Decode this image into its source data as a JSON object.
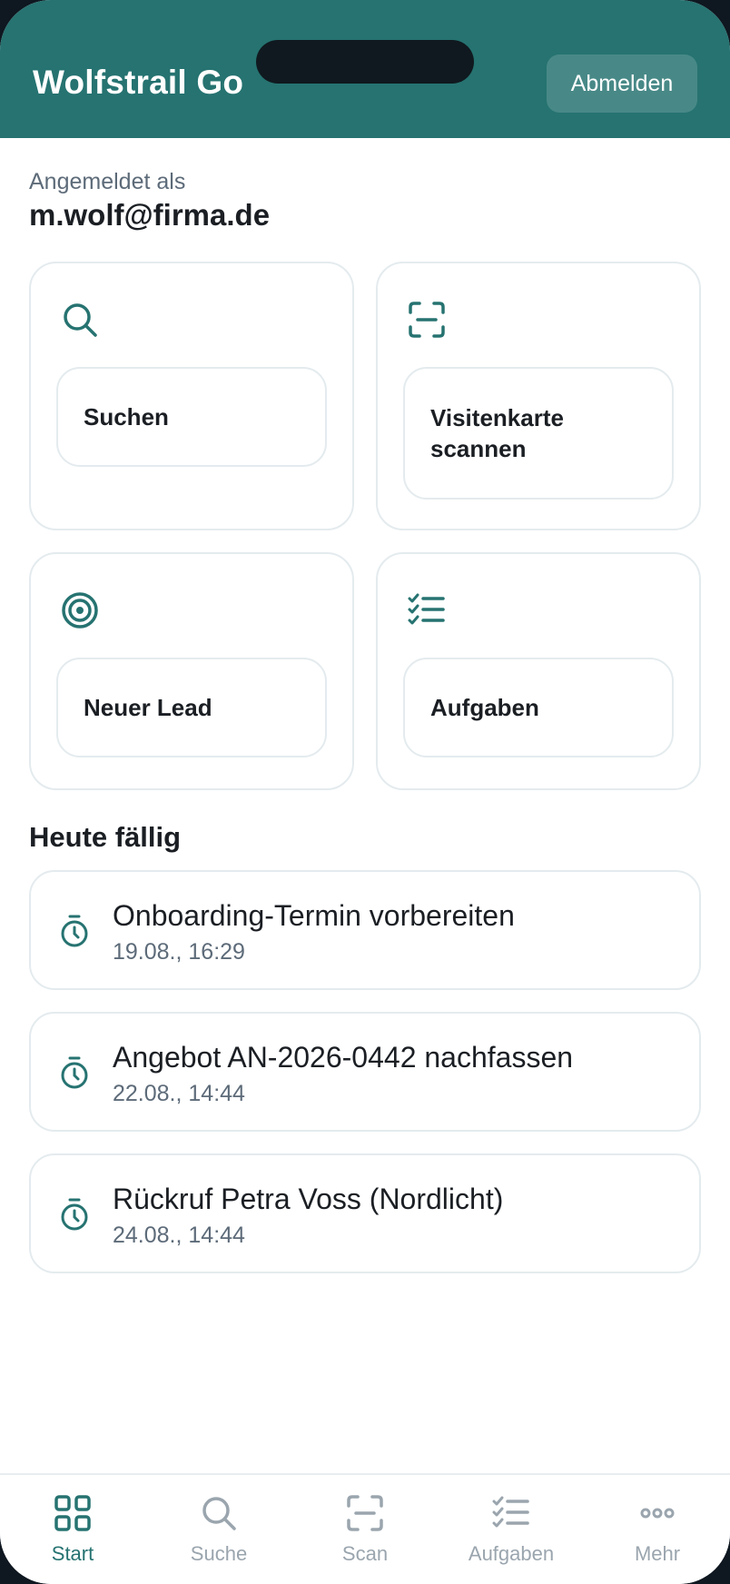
{
  "header": {
    "title": "Wolfstrail Go",
    "logout_label": "Abmelden"
  },
  "account": {
    "label": "Angemeldet als",
    "email": "m.wolf@firma.de"
  },
  "tiles": [
    {
      "label": "Suchen",
      "icon": "search-icon"
    },
    {
      "label": "Visitenkarte scannen",
      "icon": "scan-icon"
    },
    {
      "label": "Neuer Lead",
      "icon": "target-icon"
    },
    {
      "label": "Aufgaben",
      "icon": "checklist-icon"
    }
  ],
  "due_today": {
    "title": "Heute fällig",
    "tasks": [
      {
        "title": "Onboarding-Termin vorbereiten",
        "time": "19.08., 16:29",
        "icon": "timer-icon"
      },
      {
        "title": "Angebot AN-2026-0442 nachfassen",
        "time": "22.08., 14:44",
        "icon": "timer-icon"
      },
      {
        "title": "Rückruf Petra Voss (Nordlicht)",
        "time": "24.08., 14:44",
        "icon": "timer-icon"
      }
    ]
  },
  "tabbar": {
    "items": [
      {
        "label": "Start",
        "icon": "grid-icon",
        "active": true
      },
      {
        "label": "Suche",
        "icon": "search-icon",
        "active": false
      },
      {
        "label": "Scan",
        "icon": "scan-icon",
        "active": false
      },
      {
        "label": "Aufgaben",
        "icon": "checklist-icon",
        "active": false
      },
      {
        "label": "Mehr",
        "icon": "more-icon",
        "active": false
      }
    ]
  },
  "colors": {
    "accent": "#267371",
    "muted": "#5d6b79",
    "inactive_tab": "#9aa5ae",
    "border": "#e4ebee"
  }
}
